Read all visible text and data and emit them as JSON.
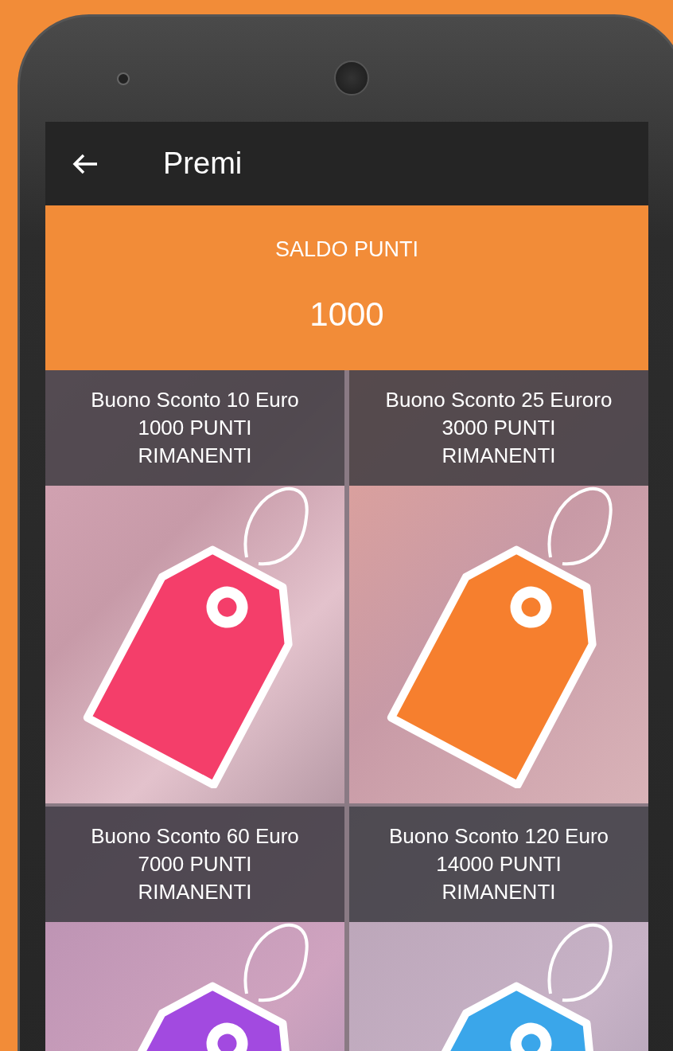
{
  "app_bar": {
    "title": "Premi"
  },
  "balance": {
    "label": "SALDO PUNTI",
    "value": "1000"
  },
  "rewards": [
    {
      "title": "Buono Sconto 10 Euro",
      "points": "1000 PUNTI RIMANENTI",
      "color": "#f43e6a"
    },
    {
      "title": "Buono Sconto 25 Euroro",
      "points": "3000 PUNTI RIMANENTI",
      "color": "#f67f2e"
    },
    {
      "title": "Buono Sconto 60 Euro",
      "points": "7000 PUNTI RIMANENTI",
      "color": "#a24ae0"
    },
    {
      "title": "Buono Sconto 120 Euro",
      "points": "14000 PUNTI RIMANENTI",
      "color": "#3aa6ea"
    }
  ]
}
